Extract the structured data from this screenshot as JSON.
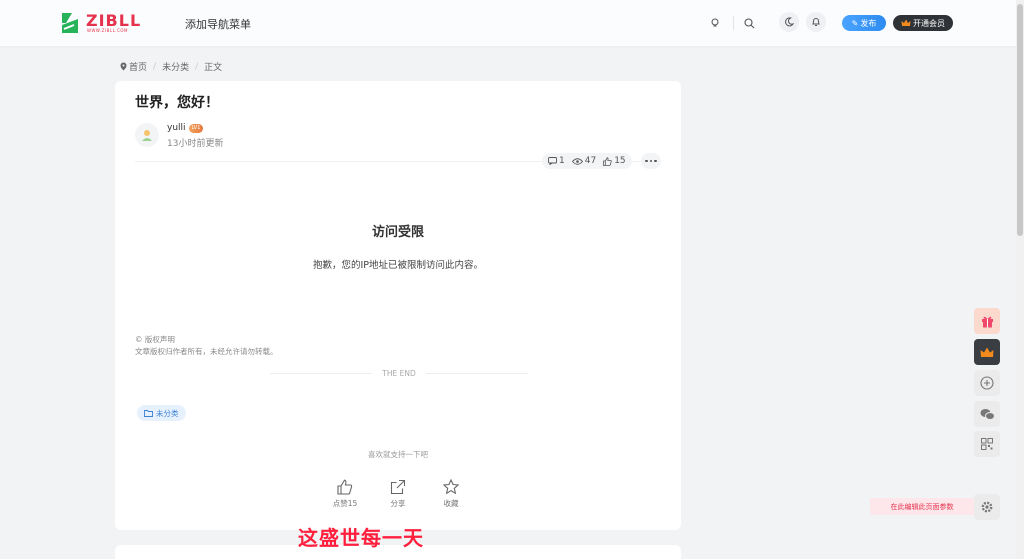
{
  "header": {
    "logo_text": "ZIBLL",
    "logo_sub": "WWW.ZIBLL.COM",
    "nav_menu": "添加导航菜单",
    "publish_label": "发布",
    "vip_label": "开通会员"
  },
  "breadcrumb": [
    "首页",
    "未分类",
    "正文"
  ],
  "post": {
    "title": "世界，您好！",
    "author": "yulli",
    "level": "LV1",
    "updated": "13小时前更新",
    "comments": "1",
    "views": "47",
    "likes": "15",
    "restrict_title": "访问受限",
    "restrict_msg": "抱歉，您的IP地址已被限制访问此内容。",
    "copyright_title": "© 版权声明",
    "copyright_text": "文章版权归作者所有，未经允许请勿转载。",
    "end_text": "THE END",
    "category": "未分类",
    "support_text": "喜欢就支持一下吧",
    "actions": {
      "like": "点赞15",
      "share": "分享",
      "favorite": "收藏"
    }
  },
  "slogan": "这盛世每一天",
  "float": {
    "edit_hint": "在此编辑此页面参数"
  },
  "colors": {
    "brand": "#e5324d",
    "logo_green": "#27b35a",
    "accent_blue": "#2d8cf0",
    "slogan_red": "#ff1f3d"
  }
}
